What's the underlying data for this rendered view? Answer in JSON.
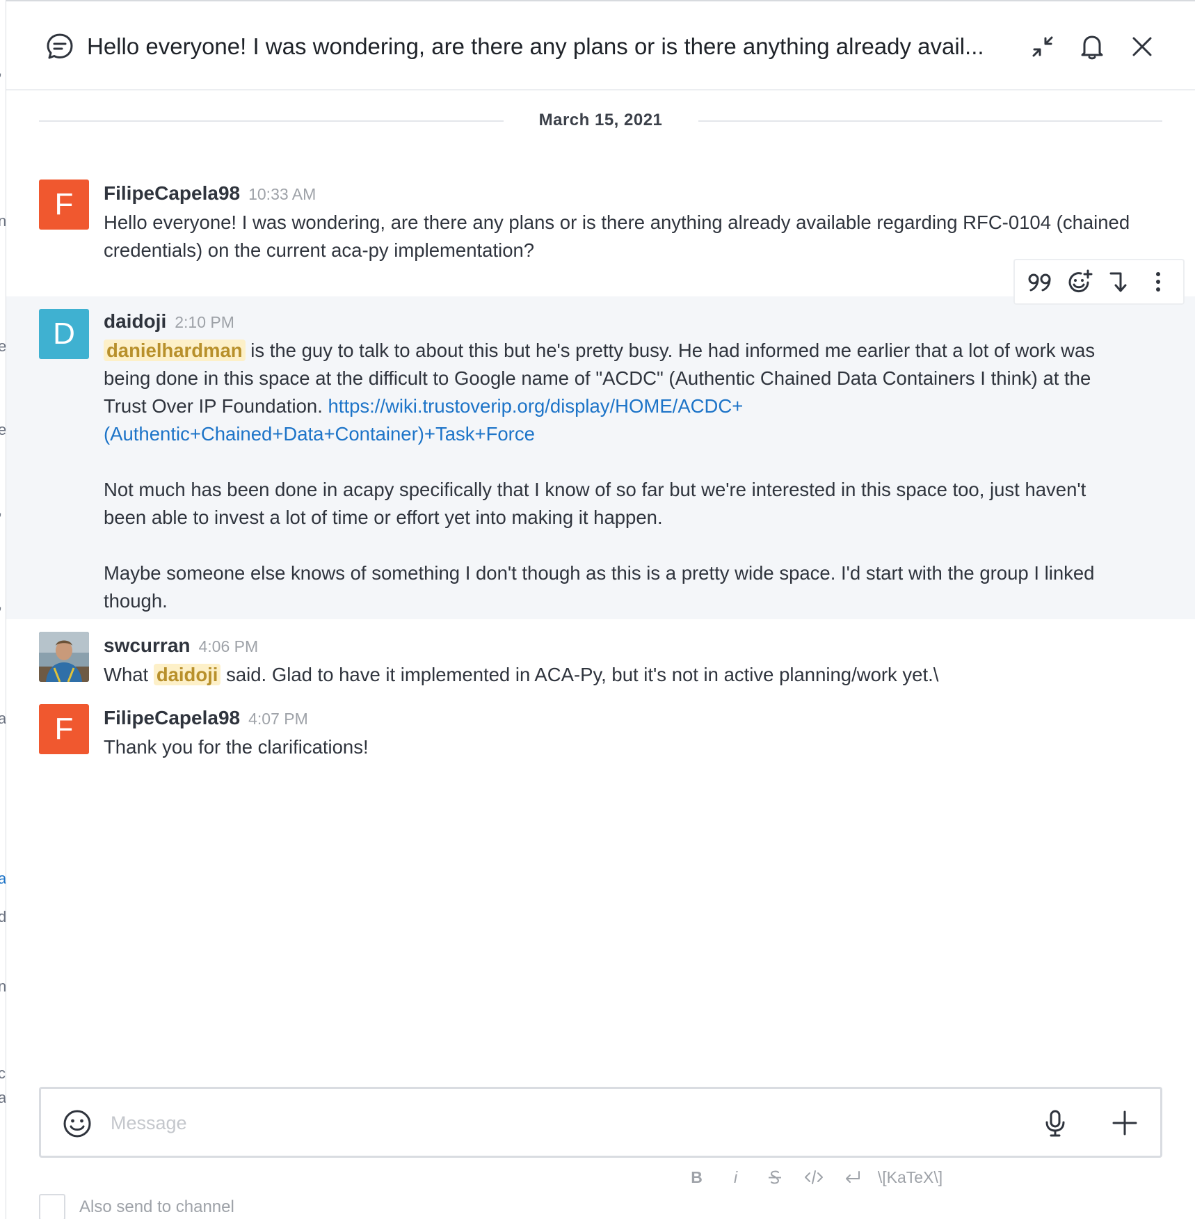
{
  "header": {
    "title": "Hello everyone! I was wondering, are there any plans or is there anything already avail...",
    "icons": [
      "thread-icon",
      "minimize-icon",
      "bell-icon",
      "close-icon"
    ]
  },
  "date_divider": "March 15, 2021",
  "messages": [
    {
      "avatar_letter": "F",
      "avatar_color": "#f0582f",
      "username": "FilipeCapela98",
      "time": "10:33 AM",
      "text": "Hello everyone! I was wondering, are there any plans or is there anything already available regarding RFC-0104 (chained credentials) on the current aca-py implementation?"
    },
    {
      "avatar_letter": "D",
      "avatar_color": "#3fb1d1",
      "username": "daidoji",
      "time": "2:10 PM",
      "mention": "danielhardman",
      "text_1": " is the guy to talk to about this but he's pretty busy. He had informed me earlier that a lot of work was being done in this space at the difficult to Google name of \"ACDC\" (Authentic Chained Data Containers I think) at the Trust Over IP Foundation. ",
      "link": "https://wiki.trustoverip.org/display/HOME/ACDC+(Authentic+Chained+Data+Container)+Task+Force",
      "link_line1": "https://wiki.trustoverip.org/display/HOME/ACDC+",
      "link_line2": "(Authentic+Chained+Data+Container)+Task+Force",
      "text_2": "Not much has been done in acapy specifically that I know of so far but we're interested in this space too, just haven't been able to invest a lot of time or effort yet into making it happen.",
      "text_3": "Maybe someone else knows of something I don't though as this is a pretty wide space. I'd start with the group I linked though."
    },
    {
      "avatar_image": "photo",
      "username": "swcurran",
      "time": "4:06 PM",
      "text_pre": "What ",
      "mention": "daidoji",
      "text_post": " said. Glad to have it implemented in ACA-Py, but it's not in active planning/work yet.\\"
    },
    {
      "avatar_letter": "F",
      "avatar_color": "#f0582f",
      "username": "FilipeCapela98",
      "time": "4:07 PM",
      "text": "Thank you for the clarifications!"
    }
  ],
  "message_toolbar": {
    "icons": [
      "quote-icon",
      "add-reaction-icon",
      "reply-in-thread-icon",
      "kebab-menu-icon"
    ]
  },
  "composer": {
    "placeholder": "Message",
    "value": ""
  },
  "formatting": {
    "bold": "B",
    "italic": "i",
    "katex": "\\[KaTeX\\]"
  },
  "also_send": {
    "label": "Also send to channel",
    "checked": false
  },
  "underlay_fragments": [
    ",",
    "n",
    "e",
    "e",
    ",",
    ",",
    "a",
    "a",
    "d",
    "n",
    "c",
    "a"
  ],
  "colors": {
    "accent_link": "#1d74c8",
    "mention_bg": "#fdf0c8",
    "mention_text": "#b8902b",
    "highlight_bg": "#f4f6f9"
  }
}
